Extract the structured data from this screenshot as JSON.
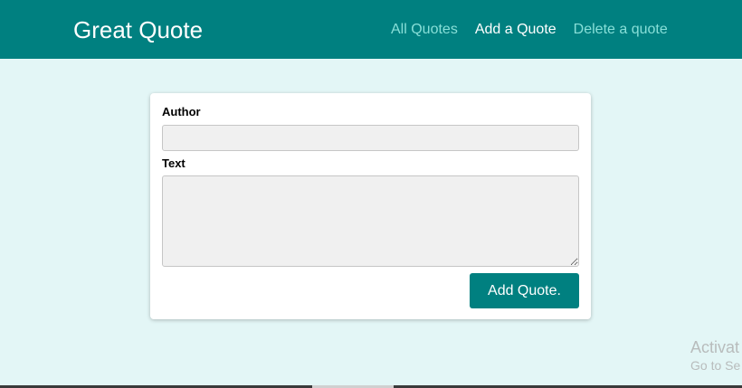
{
  "header": {
    "title": "Great Quote",
    "nav": {
      "all_quotes": "All Quotes",
      "add_quote": "Add a Quote",
      "delete_quote": "Delete a quote"
    }
  },
  "form": {
    "author_label": "Author",
    "author_value": "",
    "text_label": "Text",
    "text_value": "",
    "submit_label": "Add Quote."
  },
  "watermark": {
    "line1": "Activat",
    "line2": "Go to Se"
  },
  "colors": {
    "primary": "#008080",
    "background": "#e3f6f6",
    "nav_link": "#88dfd8",
    "nav_active": "#ffffff"
  }
}
